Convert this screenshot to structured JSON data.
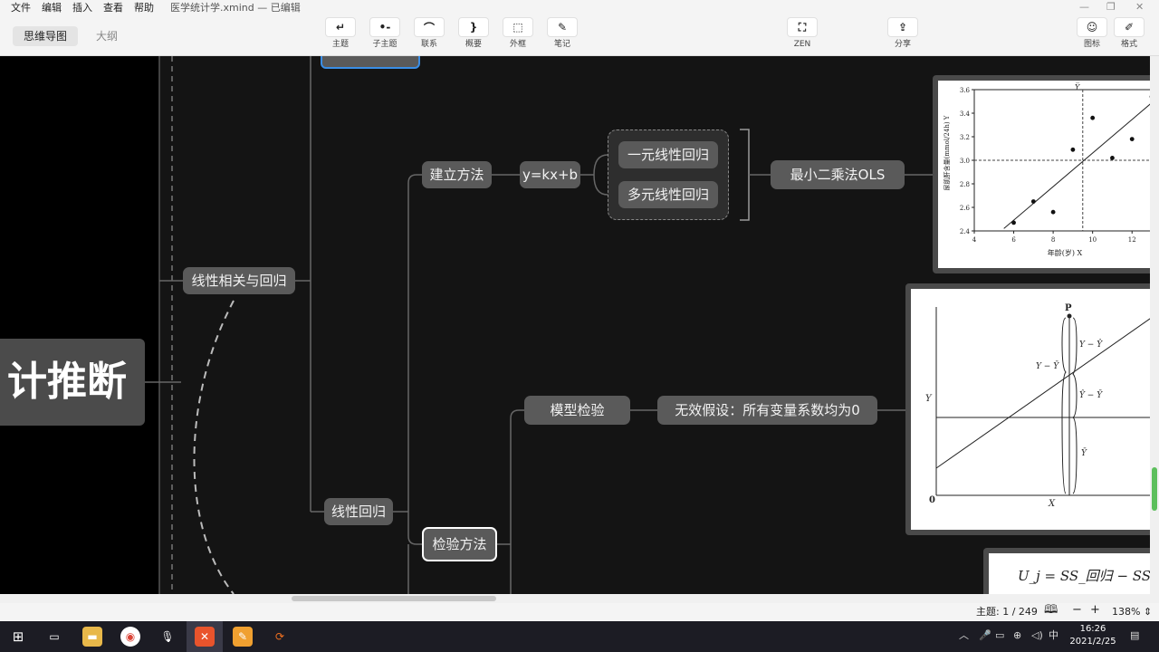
{
  "menubar": {
    "items": [
      "文件",
      "编辑",
      "插入",
      "查看",
      "帮助"
    ],
    "doc_title": "医学统计学.xmind — 已编辑"
  },
  "viewtabs": {
    "mindmap": "思维导图",
    "outline": "大纲"
  },
  "toolbar": {
    "topic": "主题",
    "subtopic": "子主题",
    "relation": "联系",
    "summary": "概要",
    "boundary": "外框",
    "note": "笔记",
    "zen": "ZEN",
    "share": "分享",
    "icon": "图标",
    "format": "格式"
  },
  "mindmap": {
    "root_text": "计推断",
    "linear_corr": "线性相关与回归",
    "linear_reg": "线性回归",
    "build_method": "建立方法",
    "formula": "y=kx+b",
    "simple_reg": "一元线性回归",
    "multi_reg": "多元线性回归",
    "ols": "最小二乘法OLS",
    "test_method": "检验方法",
    "model_test": "模型检验",
    "null_hypo": "无效假设：所有变量系数均为0"
  },
  "scatter_chart": {
    "ylabel": "尿肌酐含量(mmol/24h) Y",
    "xlabel": "年龄(岁) X",
    "y_ticks": [
      "2.4",
      "2.6",
      "2.8",
      "3.0",
      "3.2",
      "3.4",
      "3.6"
    ],
    "x_ticks": [
      "4",
      "6",
      "8",
      "10",
      "12"
    ],
    "ybar_label": "Y̅"
  },
  "chart_data": {
    "type": "scatter",
    "title": "",
    "xlabel": "年龄(岁) X",
    "ylabel": "尿肌酐含量(mmol/24h) Y",
    "xlim": [
      4,
      13
    ],
    "ylim": [
      2.4,
      3.6
    ],
    "x": [
      6,
      7,
      8,
      9,
      10,
      11,
      12,
      13
    ],
    "y": [
      2.47,
      2.65,
      2.56,
      3.09,
      3.36,
      3.02,
      3.18,
      3.54
    ],
    "mean_x": 9.5,
    "mean_y": 3.0,
    "fit_line": [
      [
        5.5,
        2.42
      ],
      [
        13.5,
        3.56
      ]
    ],
    "grid": false
  },
  "diagram_labels": {
    "p": "P",
    "y_minus_yhat": "Y − Ŷ",
    "y_minus_ybar": "Y − Ȳ",
    "yhat_minus_ybar": "Ŷ − Ȳ",
    "ybar": "Ȳ",
    "y_axis": "Y",
    "x_axis": "X",
    "origin": "0"
  },
  "formula_card": {
    "text": "U_j = SS_回归 − SS_回归(−"
  },
  "statusbar": {
    "topics": "主题: 1 / 249",
    "zoom": "138%"
  },
  "taskbar": {
    "time": "16:26",
    "date": "2021/2/25",
    "ime": "中"
  }
}
